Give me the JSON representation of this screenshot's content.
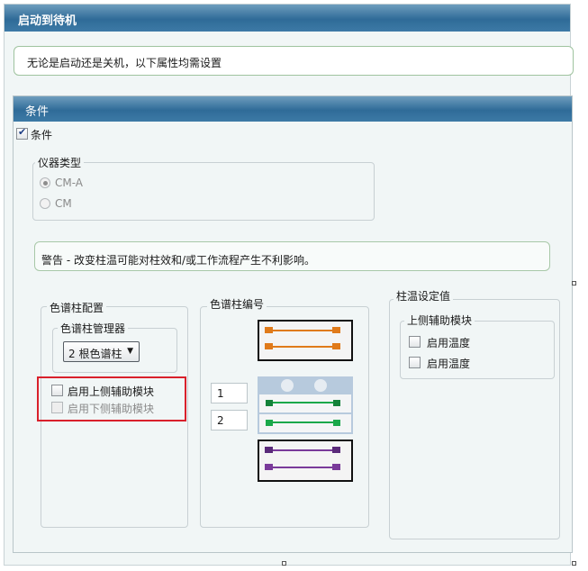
{
  "window": {
    "title": "启动到待机"
  },
  "info_text": "无论是启动还是关机，以下属性均需设置",
  "conditions": {
    "section_title": "条件",
    "enable_checkbox": {
      "label": "条件",
      "checked": true
    },
    "instrument_type": {
      "legend": "仪器类型",
      "options": [
        {
          "label": "CM-A",
          "selected": true
        },
        {
          "label": "CM",
          "selected": false
        }
      ]
    },
    "warning_text": "警告 - 改变柱温可能对柱效和/或工作流程产生不利影响。",
    "column_config": {
      "legend": "色谱柱配置",
      "manager": {
        "legend": "色谱柱管理器",
        "value": "2 根色谱柱"
      },
      "upper_aux": {
        "label": "启用上侧辅助模块",
        "checked": false
      },
      "lower_aux": {
        "label": "启用下侧辅助模块",
        "checked": false
      }
    },
    "column_numbers": {
      "legend": "色谱柱编号",
      "values": [
        "1",
        "2"
      ],
      "colors": {
        "top": "#e07a1a",
        "green": "#1aa84a",
        "purple": "#7a3a9a"
      }
    },
    "temperature": {
      "legend": "柱温设定值",
      "upper_module": {
        "legend": "上侧辅助模块",
        "items": [
          {
            "label": "启用温度",
            "checked": false
          },
          {
            "label": "启用温度",
            "checked": false
          }
        ]
      }
    }
  }
}
